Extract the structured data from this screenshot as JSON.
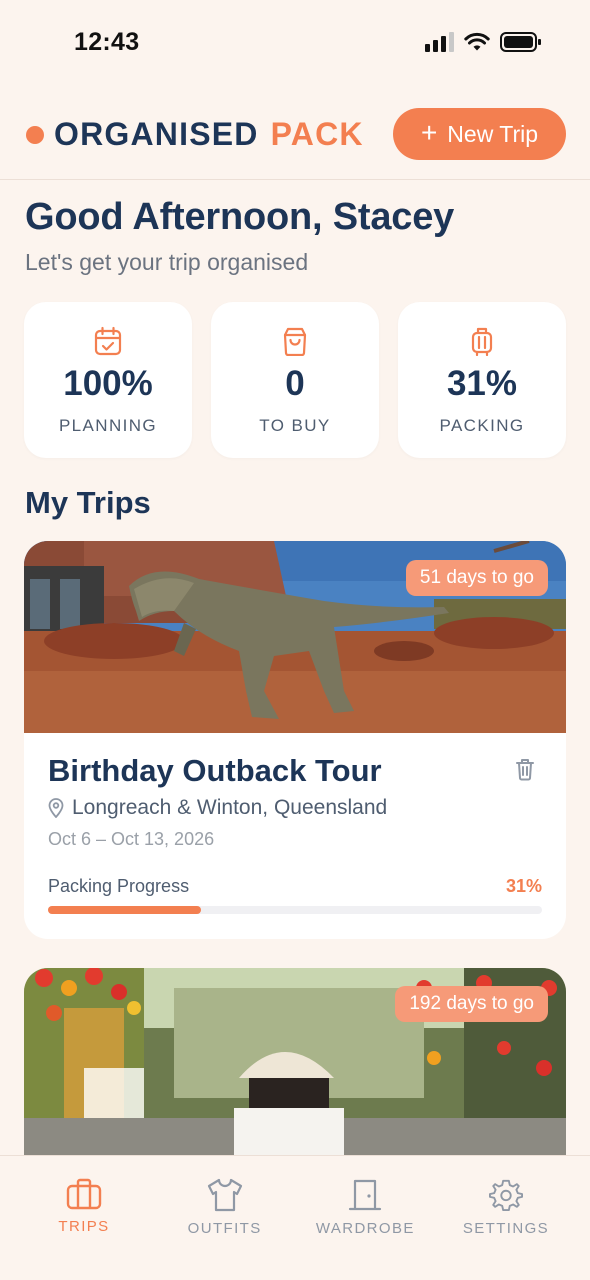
{
  "status_bar": {
    "time": "12:43",
    "battery_icon": "battery-icon",
    "wifi_icon": "wifi-icon",
    "signal_icon": "signal-icon"
  },
  "header": {
    "logo_word1": "ORGANISED",
    "logo_word2": "PACK",
    "new_trip_plus": "+",
    "new_trip_label": "New Trip"
  },
  "greeting": {
    "title": "Good Afternoon, Stacey",
    "subtitle": "Let's get your trip organised"
  },
  "stats": [
    {
      "icon": "calendar-check-icon",
      "value": "100%",
      "label": "PLANNING"
    },
    {
      "icon": "shopping-bag-icon",
      "value": "0",
      "label": "TO BUY"
    },
    {
      "icon": "luggage-icon",
      "value": "31%",
      "label": "PACKING"
    }
  ],
  "my_trips": {
    "title": "My Trips",
    "trips": [
      {
        "badge": "51 days to go",
        "title": "Birthday Outback Tour",
        "location": "Longreach & Winton, Queensland",
        "dates": "Oct 6 – Oct 13, 2026",
        "progress_label": "Packing Progress",
        "progress_text": "31%",
        "progress": 0.31
      },
      {
        "badge": "192 days to go"
      }
    ]
  },
  "bottom_nav": [
    {
      "icon": "briefcase-icon",
      "label": "TRIPS",
      "active": true
    },
    {
      "icon": "shirt-icon",
      "label": "OUTFITS",
      "active": false
    },
    {
      "icon": "door-icon",
      "label": "WARDROBE",
      "active": false
    },
    {
      "icon": "gear-icon",
      "label": "SETTINGS",
      "active": false
    }
  ],
  "colors": {
    "accent": "#f37f50",
    "navy": "#1d3557",
    "background": "#fcf4ee",
    "badge": "#f69a78"
  }
}
